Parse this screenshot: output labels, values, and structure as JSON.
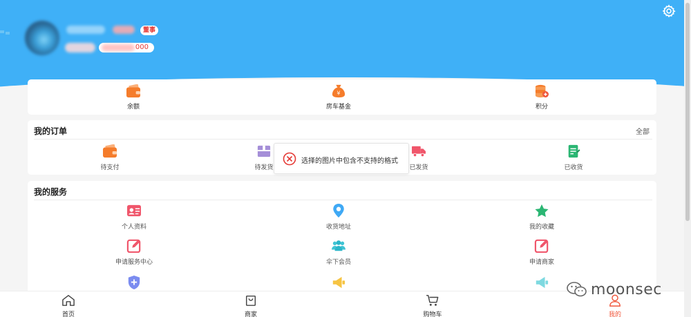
{
  "profile": {
    "badge": "董事",
    "points_suffix": "000"
  },
  "balance": {
    "items": [
      {
        "icon": "wallet-icon",
        "label": "余额"
      },
      {
        "icon": "money-bag-icon",
        "label": "房车基金"
      },
      {
        "icon": "coins-icon",
        "label": "积分"
      }
    ]
  },
  "orders": {
    "title": "我的订单",
    "more": "全部",
    "items": [
      {
        "icon": "wallet-icon",
        "label": "待支付"
      },
      {
        "icon": "package-icon",
        "label": "待发货"
      },
      {
        "icon": "truck-icon",
        "label": "已发货"
      },
      {
        "icon": "document-icon",
        "label": "已收货"
      }
    ]
  },
  "services": {
    "title": "我的服务",
    "items": [
      {
        "icon": "id-card-icon",
        "label": "个人资料"
      },
      {
        "icon": "location-pin-icon",
        "label": "收货地址"
      },
      {
        "icon": "star-icon",
        "label": "我的收藏"
      },
      {
        "icon": "edit-icon",
        "label": "申请服务中心"
      },
      {
        "icon": "team-icon",
        "label": "伞下会员"
      },
      {
        "icon": "edit-icon",
        "label": "申请商家"
      },
      {
        "icon": "shield-icon",
        "label": ""
      },
      {
        "icon": "megaphone-icon",
        "label": ""
      },
      {
        "icon": "megaphone-icon",
        "label": ""
      }
    ]
  },
  "toast": {
    "icon": "error-circle-icon",
    "message": "选择的图片中包含不支持的格式"
  },
  "tabbar": {
    "items": [
      {
        "icon": "home-icon",
        "label": "首页"
      },
      {
        "icon": "shop-bag-icon",
        "label": "商家"
      },
      {
        "icon": "cart-icon",
        "label": "购物车"
      },
      {
        "icon": "user-icon",
        "label": "我的",
        "active": true
      }
    ]
  },
  "watermark": {
    "text": "moonsec"
  },
  "colors": {
    "header": "#3fb0f7",
    "accent": "#f0563b",
    "orange": "#f57c2b",
    "green": "#2bb673",
    "blue": "#3fa9f5",
    "error": "#e53935"
  }
}
